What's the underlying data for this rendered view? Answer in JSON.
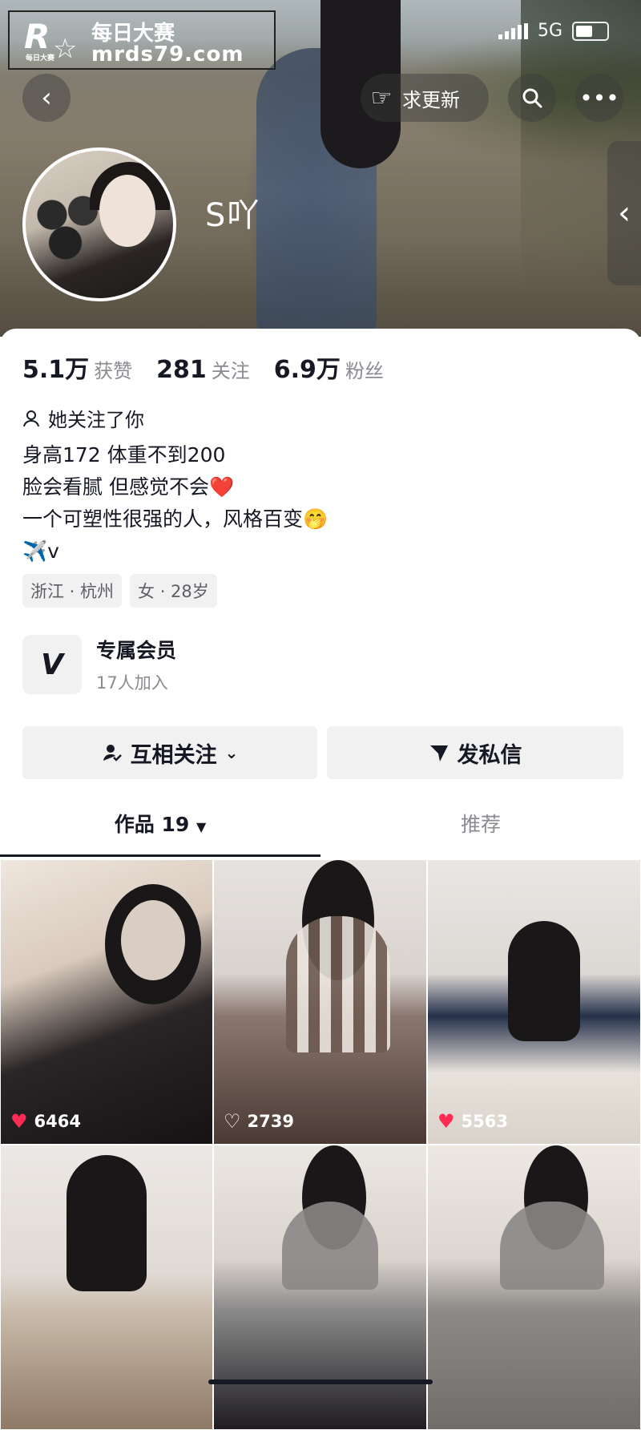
{
  "watermark": {
    "logo_letter": "R",
    "logo_small": "每日大赛",
    "title": "每日大赛",
    "url": "mrds79.com"
  },
  "status_bar": {
    "network": "5G"
  },
  "header": {
    "back_icon": "chevron-left-icon",
    "update_label": "求更新",
    "search_icon": "search-icon",
    "more_icon": "more-icon"
  },
  "profile": {
    "nickname": "S吖",
    "stats": [
      {
        "value": "5.1万",
        "label": "获赞"
      },
      {
        "value": "281",
        "label": "关注"
      },
      {
        "value": "6.9万",
        "label": "粉丝"
      }
    ],
    "follows_you": "她关注了你",
    "bio": [
      "身高172  体重不到200",
      "脸会看腻 但感觉不会❤️",
      "一个可塑性很强的人，风格百变🤭",
      "✈️v"
    ],
    "tags": [
      "浙江 · 杭州",
      "女 · 28岁"
    ]
  },
  "member": {
    "title": "专属会员",
    "subtitle": "17人加入"
  },
  "actions": {
    "mutual_follow": "互相关注",
    "message": "发私信"
  },
  "tabs": [
    {
      "label": "作品 19"
    },
    {
      "label": "推荐"
    }
  ],
  "videos": [
    {
      "likes": "6464",
      "liked": true
    },
    {
      "likes": "2739",
      "liked": false
    },
    {
      "likes": "5563",
      "liked": true
    },
    {
      "likes": "",
      "liked": false
    },
    {
      "likes": "",
      "liked": false
    },
    {
      "likes": "",
      "liked": false
    }
  ],
  "colors": {
    "accent": "#fe2c55",
    "text": "#161823",
    "muted": "#8a8b91",
    "button_bg": "#f1f1f2"
  }
}
